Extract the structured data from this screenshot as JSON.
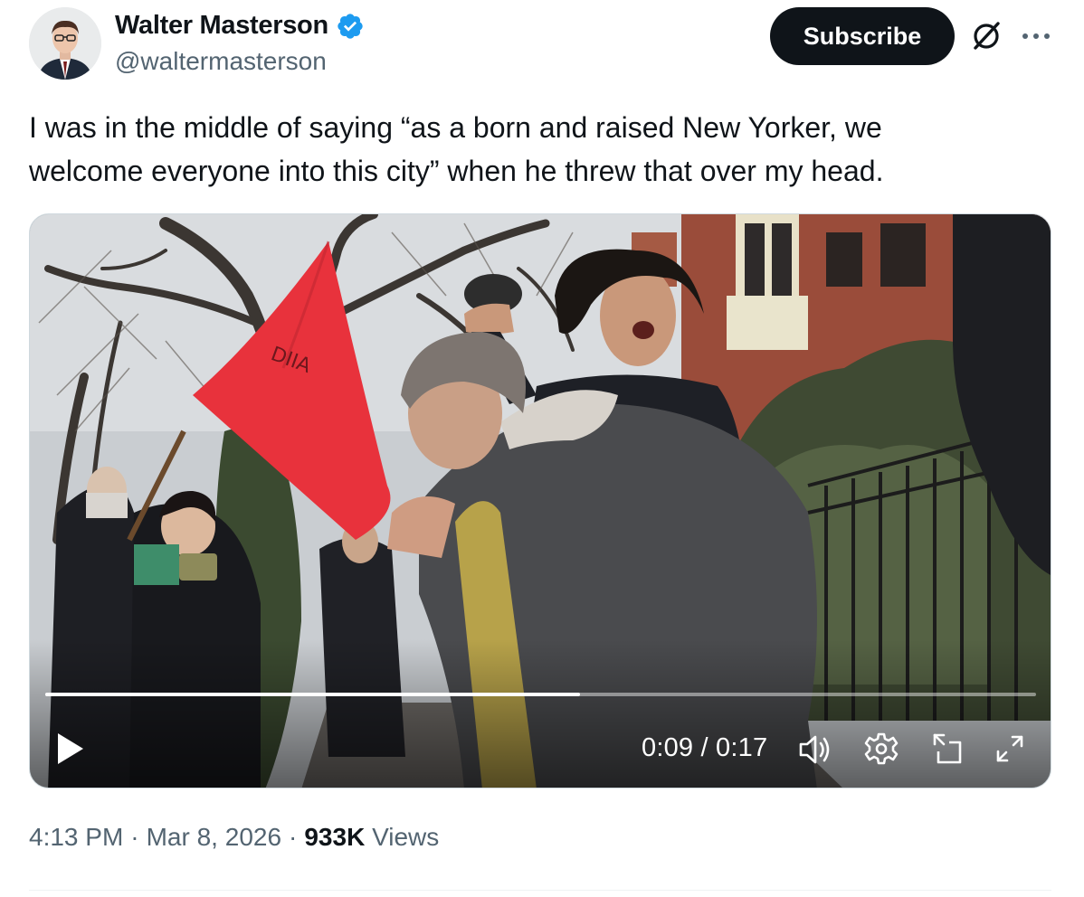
{
  "author": {
    "display_name": "Walter Masterson",
    "handle": "@waltermasterson",
    "verified": true
  },
  "actions": {
    "subscribe_label": "Subscribe",
    "grok_icon": "grok-icon",
    "more_icon": "more-icon"
  },
  "tweet": {
    "text_line1": "I was in the middle of saying “as a born and raised New Yorker, we",
    "text_line2": "welcome everyone into this city” when he threw that over my head."
  },
  "video": {
    "current_time": "0:09",
    "separator": " / ",
    "duration": "0:17",
    "progress_fraction": 0.54,
    "controls": [
      "play-icon",
      "volume-icon",
      "gear-icon",
      "picture-in-picture-icon",
      "expand-icon"
    ]
  },
  "meta": {
    "time": "4:13 PM",
    "dot1": "·",
    "date": "Mar 8, 2026",
    "dot2": "·",
    "views_count": "933K",
    "views_label": "Views"
  },
  "colors": {
    "verified_blue": "#1d9bf0",
    "text_primary": "#0f1419",
    "text_secondary": "#536471",
    "flag_red": "#e8323c"
  }
}
